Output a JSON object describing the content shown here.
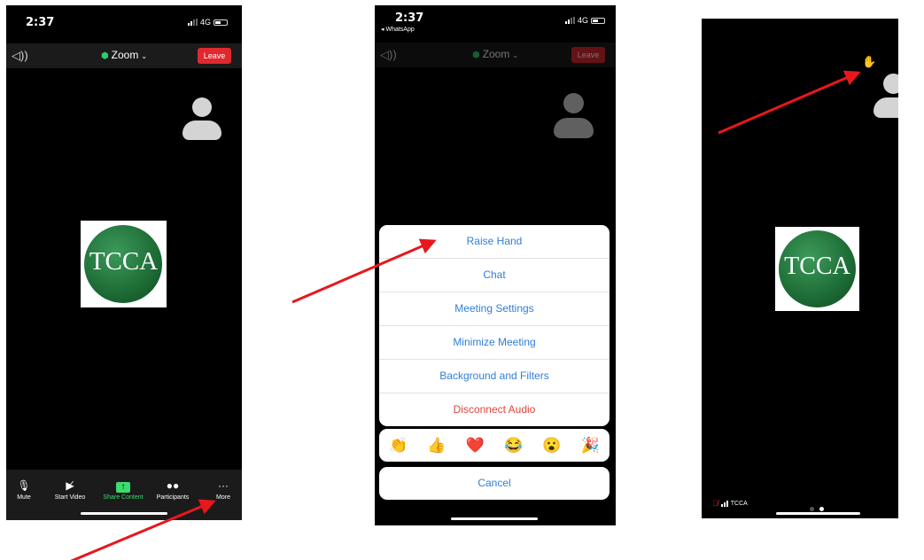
{
  "screen1": {
    "status": {
      "time": "2:37",
      "network": "4G"
    },
    "header": {
      "title": "Zoom",
      "leave_label": "Leave"
    },
    "logo_text": "TCCA",
    "toolbar": [
      {
        "label": "Mute",
        "icon": "mic-icon"
      },
      {
        "label": "Start Video",
        "icon": "video-off-icon"
      },
      {
        "label": "Share Content",
        "icon": "share-icon"
      },
      {
        "label": "Participants",
        "icon": "participants-icon"
      },
      {
        "label": "More",
        "icon": "more-icon"
      }
    ]
  },
  "screen2": {
    "status": {
      "time": "2:37",
      "back_app": "◂ WhatsApp",
      "network": "4G"
    },
    "header": {
      "title": "Zoom",
      "leave_label": "Leave"
    },
    "menu": [
      {
        "label": "Raise Hand"
      },
      {
        "label": "Chat"
      },
      {
        "label": "Meeting Settings"
      },
      {
        "label": "Minimize Meeting"
      },
      {
        "label": "Background and Filters"
      },
      {
        "label": "Disconnect Audio"
      }
    ],
    "reactions": [
      "👏",
      "👍",
      "❤️",
      "😂",
      "😮",
      "🎉"
    ],
    "cancel_label": "Cancel"
  },
  "screen3": {
    "logo_text": "TCCA",
    "raised_hand": "✋",
    "participant_name": "TCCA"
  },
  "colors": {
    "arrow": "#e8171c",
    "accent_blue": "#2f7fd8",
    "leave_red": "#e0282f",
    "share_green": "#3ddc6f"
  }
}
